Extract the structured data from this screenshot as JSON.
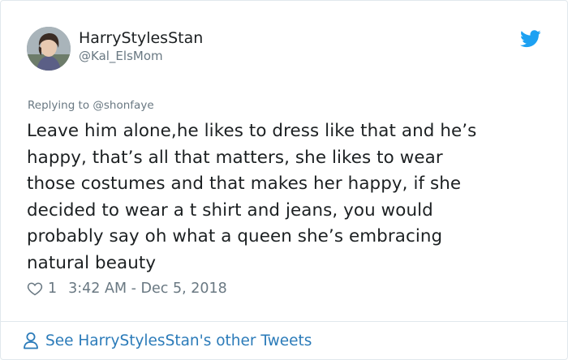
{
  "author": {
    "display_name": "HarryStylesStan",
    "handle": "@Kal_ElsMom"
  },
  "tweet": {
    "replying_to": "Replying to @shonfaye",
    "text_lines": [
      "Leave him alone,he likes to dress like that and he’s",
      "happy, that’s all that matters, she likes to wear",
      "those costumes and that makes her happy, if she",
      "decided to wear a t shirt and jeans, you would",
      "probably say oh what a queen she’s embracing",
      "natural beauty"
    ],
    "like_count": "1",
    "timestamp": "3:42 AM - Dec 5, 2018"
  },
  "footer": {
    "see_more_label": "See HarryStylesStan's other Tweets"
  },
  "icons": {
    "brand": "twitter-bird-icon",
    "like": "heart-outline-icon",
    "profile": "person-outline-icon"
  },
  "colors": {
    "brand_blue": "#1da1f2",
    "link_blue": "#2b7bb9",
    "text": "#1c2022",
    "muted": "#697882",
    "border": "#e1e8ed"
  }
}
